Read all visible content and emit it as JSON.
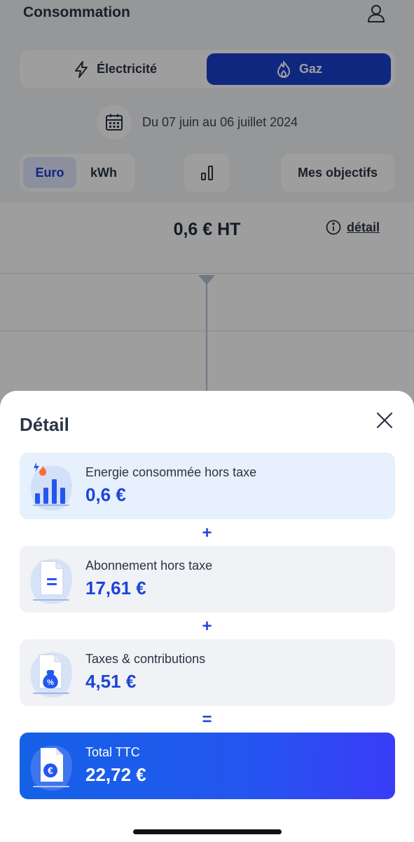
{
  "header": {
    "title": "Consommation",
    "account_icon": "user-icon"
  },
  "energy_toggle": {
    "options": [
      {
        "label": "Électricité",
        "icon": "lightning-icon",
        "selected": false
      },
      {
        "label": "Gaz",
        "icon": "flame-icon",
        "selected": true
      }
    ]
  },
  "period": {
    "icon": "calendar-icon",
    "text": "Du 07 juin au 06 juillet 2024"
  },
  "unit_toggle": {
    "options": [
      {
        "label": "Euro",
        "selected": true
      },
      {
        "label": "kWh",
        "selected": false
      }
    ]
  },
  "chart_toggle": {
    "icon": "bar-chart-icon"
  },
  "objectives": {
    "label": "Mes objectifs"
  },
  "summary": {
    "amount": "0,6 € HT",
    "detail_label": "détail",
    "detail_icon": "info-icon"
  },
  "sheet": {
    "title": "Détail",
    "close_icon": "close-icon",
    "operators": [
      "+",
      "+",
      "="
    ],
    "items": [
      {
        "label": "Energie consommée hors taxe",
        "value": "0,6 €",
        "icon": "energy-usage-icon"
      },
      {
        "label": "Abonnement hors taxe",
        "value": "17,61 €",
        "icon": "document-equals-icon"
      },
      {
        "label": "Taxes & contributions",
        "value": "4,51 €",
        "icon": "document-percent-icon"
      },
      {
        "label": "Total TTC",
        "value": "22,72 €",
        "icon": "document-euro-icon"
      }
    ]
  },
  "colors": {
    "primary": "#1a3fcf",
    "value_blue": "#1d44d6",
    "energy_card_bg": "#e7f0fd",
    "card_bg": "#f0f2f5",
    "total_gradient_start": "#1461e6",
    "total_gradient_end": "#3a3cf7"
  }
}
